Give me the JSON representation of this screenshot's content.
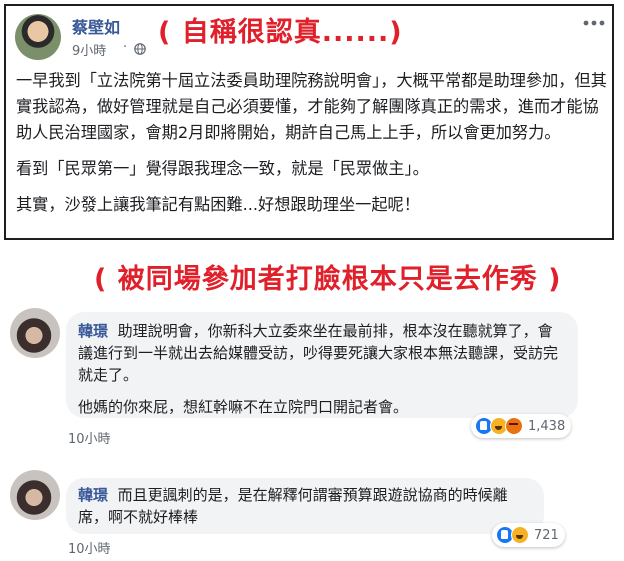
{
  "post": {
    "author": "蔡壁如",
    "timestamp": "9小時",
    "separator": "·",
    "annotation": "( 自稱很認真......)",
    "paragraphs": [
      "一早我到「立法院第十屆立法委員助理院務說明會」，大概平常都是助理參加，但其實我認為，做好管理就是自己必須要懂，才能夠了解團隊真正的需求，進而才能協助人民治理國家，會期2月即將開始，期許自己馬上上手，所以會更加努力。",
      "看到「民眾第一」覺得跟我理念一致，就是「民眾做主」。",
      "其實，沙發上讓我筆記有點困難...好想跟助理坐一起呢！"
    ],
    "icons": {
      "visibility": "globe-icon",
      "menu": "more-icon"
    }
  },
  "annotation_mid": "( 被同場參加者打臉根本只是去作秀 )",
  "comments": [
    {
      "author": "韓璟",
      "text1": "助理說明會，你新科大立委來坐在最前排，根本沒在聽就算了，會議進行到一半就出去給媒體受訪，吵得要死讓大家根本無法聽課，受訪完就走了。",
      "text2": "他媽的你來屁，想紅幹嘛不在立院門口開記者會。",
      "timestamp": "10小時",
      "reaction_count": "1,438",
      "reactions": [
        "like",
        "haha",
        "angry"
      ]
    },
    {
      "author": "韓璟",
      "text1": "而且更諷刺的是，是在解釋何謂審預算跟遊說協商的時候離席，啊不就好棒棒",
      "timestamp": "10小時",
      "reaction_count": "721",
      "reactions": [
        "like",
        "haha"
      ]
    }
  ],
  "colors": {
    "link": "#385898",
    "annotation": "#e0202a",
    "like": "#1877f2",
    "haha": "#f7b125",
    "angry": "#e9710f"
  }
}
